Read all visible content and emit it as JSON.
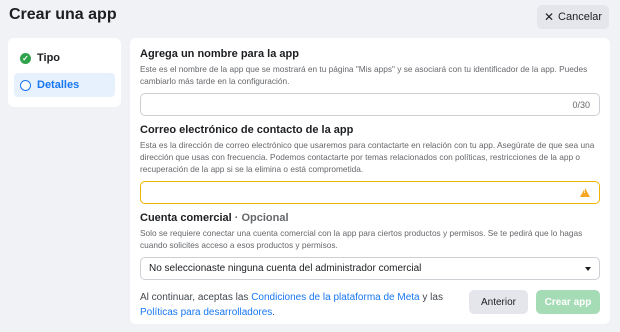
{
  "header": {
    "title": "Crear una app",
    "cancel_label": "Cancelar"
  },
  "steps": [
    {
      "label": "Tipo",
      "state": "done"
    },
    {
      "label": "Detalles",
      "state": "active"
    }
  ],
  "form": {
    "name": {
      "title": "Agrega un nombre para la app",
      "description": "Este es el nombre de la app que se mostrará en tu página \"Mis apps\" y se asociará con tu identificador de la app. Puedes cambiarlo más tarde en la configuración.",
      "counter": "0/30",
      "value": ""
    },
    "email": {
      "title": "Correo electrónico de contacto de la app",
      "description": "Esta es la dirección de correo electrónico que usaremos para contactarte en relación con tu app. Asegúrate de que sea una dirección que usas con frecuencia. Podemos contactarte por temas relacionados con políticas, restricciones de la app o recuperación de la app si se la elimina o está comprometida.",
      "value": ""
    },
    "business": {
      "title": "Cuenta comercial",
      "optional": " · Opcional",
      "description": "Solo se requiere conectar una cuenta comercial con la app para ciertos productos y permisos. Se te pedirá que lo hagas cuando solicites acceso a esos productos y permisos.",
      "selected": "No seleccionaste ninguna cuenta del administrador comercial"
    }
  },
  "footer": {
    "terms_prefix": "Al continuar, aceptas las ",
    "terms_link1": "Condiciones de la plataforma de Meta",
    "terms_mid": " y las ",
    "terms_link2": "Políticas para desarrolladores",
    "terms_suffix": ".",
    "back_label": "Anterior",
    "create_label": "Crear app"
  },
  "colors": {
    "accent": "#1877f2",
    "success": "#31a24c",
    "warning": "#f0b400",
    "disabled_green": "#a5dbb5"
  }
}
